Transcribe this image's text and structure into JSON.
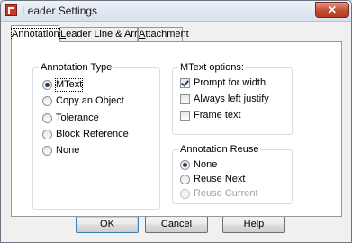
{
  "window": {
    "title": "Leader Settings",
    "close_label": "✕"
  },
  "tabs": [
    {
      "label_pre": "Annotation",
      "label_u": "",
      "label_post": ""
    },
    {
      "label_pre": "",
      "label_u": "L",
      "label_post": "eader Line & Arrow"
    },
    {
      "label_pre": "",
      "label_u": "A",
      "label_post": "ttachment"
    }
  ],
  "annotation_type": {
    "group_label": "Annotation Type",
    "options": [
      {
        "pre": "",
        "u": "M",
        "post": "Text",
        "selected": true
      },
      {
        "pre": "",
        "u": "C",
        "post": "opy an Object",
        "selected": false
      },
      {
        "pre": "",
        "u": "T",
        "post": "olerance",
        "selected": false
      },
      {
        "pre": "",
        "u": "B",
        "post": "lock Reference",
        "selected": false
      },
      {
        "pre": "N",
        "u": "o",
        "post": "ne",
        "selected": false
      }
    ]
  },
  "mtext_options": {
    "group_label": "MText options:",
    "options": [
      {
        "pre": "Prompt for ",
        "u": "w",
        "post": "idth",
        "checked": true
      },
      {
        "pre": "Always ",
        "u": "l",
        "post": "eft justify",
        "checked": false
      },
      {
        "pre": "",
        "u": "F",
        "post": "rame text",
        "checked": false
      }
    ]
  },
  "annotation_reuse": {
    "group_label": "Annotation Reuse",
    "options": [
      {
        "pre": "N",
        "u": "o",
        "post": "ne",
        "selected": true,
        "disabled": false
      },
      {
        "pre": "Reuse N",
        "u": "e",
        "post": "xt",
        "selected": false,
        "disabled": false
      },
      {
        "pre": "Reuse C",
        "u": "u",
        "post": "rrent",
        "selected": false,
        "disabled": true
      }
    ]
  },
  "buttons": {
    "ok": "OK",
    "cancel": "Cancel",
    "help_u": "H",
    "help_post": "elp"
  }
}
